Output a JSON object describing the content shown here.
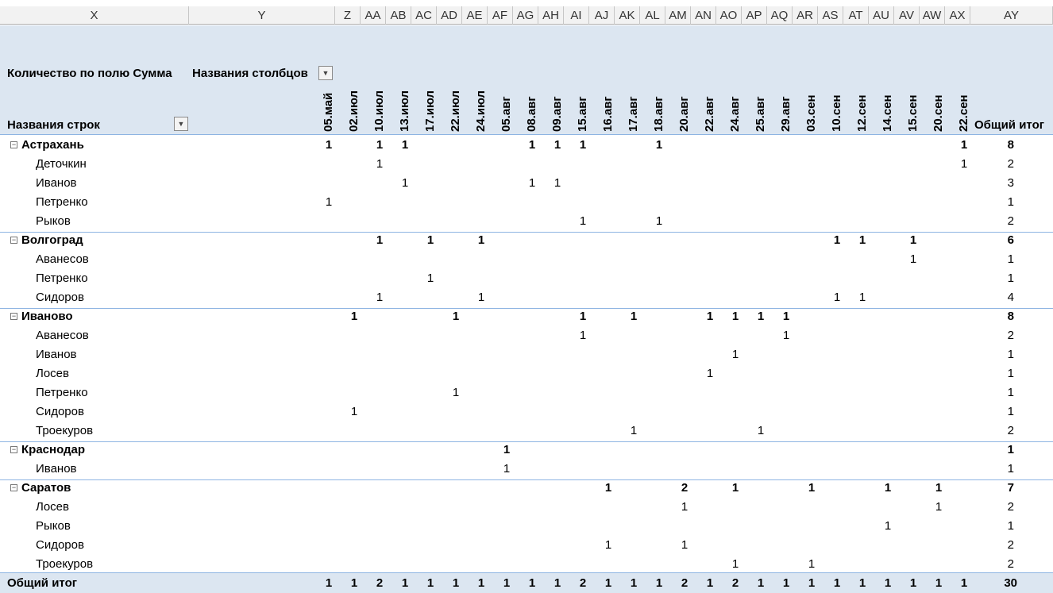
{
  "column_headers": [
    "X",
    "Y",
    "Z",
    "AA",
    "AB",
    "AC",
    "AD",
    "AE",
    "AF",
    "AG",
    "AH",
    "AI",
    "AJ",
    "AK",
    "AL",
    "AM",
    "AN",
    "AO",
    "AP",
    "AQ",
    "AR",
    "AS",
    "AT",
    "AU",
    "AV",
    "AW",
    "AX",
    "AY"
  ],
  "pivot": {
    "values_label": "Количество по полю Сумма",
    "columns_label": "Названия столбцов",
    "rows_label": "Названия строк",
    "grand_total_label": "Общий итог",
    "dates": [
      "05.май",
      "02.июл",
      "10.июл",
      "13.июл",
      "17.июл",
      "22.июл",
      "24.июл",
      "05.авг",
      "08.авг",
      "09.авг",
      "15.авг",
      "16.авг",
      "17.авг",
      "18.авг",
      "20.авг",
      "22.авг",
      "24.авг",
      "25.авг",
      "29.авг",
      "03.сен",
      "10.сен",
      "12.сен",
      "14.сен",
      "15.сен",
      "20.сен",
      "22.сен"
    ],
    "rows": [
      {
        "label": "Астрахань",
        "level": 0,
        "cells": {
          "0": "1",
          "2": "1",
          "3": "1",
          "8": "1",
          "9": "1",
          "10": "1",
          "13": "1",
          "25": "1"
        },
        "total": "8"
      },
      {
        "label": "Деточкин",
        "level": 1,
        "cells": {
          "2": "1",
          "25": "1"
        },
        "total": "2"
      },
      {
        "label": "Иванов",
        "level": 1,
        "cells": {
          "3": "1",
          "8": "1",
          "9": "1"
        },
        "total": "3"
      },
      {
        "label": "Петренко",
        "level": 1,
        "cells": {
          "0": "1"
        },
        "total": "1"
      },
      {
        "label": "Рыков",
        "level": 1,
        "cells": {
          "10": "1",
          "13": "1"
        },
        "total": "2"
      },
      {
        "label": "Волгоград",
        "level": 0,
        "cells": {
          "2": "1",
          "4": "1",
          "6": "1",
          "20": "1",
          "21": "1",
          "23": "1"
        },
        "total": "6"
      },
      {
        "label": "Аванесов",
        "level": 1,
        "cells": {
          "23": "1"
        },
        "total": "1"
      },
      {
        "label": "Петренко",
        "level": 1,
        "cells": {
          "4": "1"
        },
        "total": "1"
      },
      {
        "label": "Сидоров",
        "level": 1,
        "cells": {
          "2": "1",
          "6": "1",
          "20": "1",
          "21": "1"
        },
        "total": "4"
      },
      {
        "label": "Иваново",
        "level": 0,
        "cells": {
          "1": "1",
          "5": "1",
          "10": "1",
          "12": "1",
          "15": "1",
          "16": "1",
          "17": "1",
          "18": "1"
        },
        "total": "8"
      },
      {
        "label": "Аванесов",
        "level": 1,
        "cells": {
          "10": "1",
          "18": "1"
        },
        "total": "2"
      },
      {
        "label": "Иванов",
        "level": 1,
        "cells": {
          "16": "1"
        },
        "total": "1"
      },
      {
        "label": "Лосев",
        "level": 1,
        "cells": {
          "15": "1"
        },
        "total": "1"
      },
      {
        "label": "Петренко",
        "level": 1,
        "cells": {
          "5": "1"
        },
        "total": "1"
      },
      {
        "label": "Сидоров",
        "level": 1,
        "cells": {
          "1": "1"
        },
        "total": "1"
      },
      {
        "label": "Троекуров",
        "level": 1,
        "cells": {
          "12": "1",
          "17": "1"
        },
        "total": "2"
      },
      {
        "label": "Краснодар",
        "level": 0,
        "cells": {
          "7": "1"
        },
        "total": "1"
      },
      {
        "label": "Иванов",
        "level": 1,
        "cells": {
          "7": "1"
        },
        "total": "1"
      },
      {
        "label": "Саратов",
        "level": 0,
        "cells": {
          "11": "1",
          "14": "2",
          "16": "1",
          "19": "1",
          "22": "1",
          "24": "1"
        },
        "total": "7"
      },
      {
        "label": "Лосев",
        "level": 1,
        "cells": {
          "14": "1",
          "24": "1"
        },
        "total": "2"
      },
      {
        "label": "Рыков",
        "level": 1,
        "cells": {
          "22": "1"
        },
        "total": "1"
      },
      {
        "label": "Сидоров",
        "level": 1,
        "cells": {
          "11": "1",
          "14": "1"
        },
        "total": "2"
      },
      {
        "label": "Троекуров",
        "level": 1,
        "cells": {
          "16": "1",
          "19": "1"
        },
        "total": "2"
      }
    ],
    "grand_total_row": {
      "cells": [
        "1",
        "1",
        "2",
        "1",
        "1",
        "1",
        "1",
        "1",
        "1",
        "1",
        "2",
        "1",
        "1",
        "1",
        "2",
        "1",
        "2",
        "1",
        "1",
        "1",
        "1",
        "1",
        "1",
        "1",
        "1",
        "1"
      ],
      "total": "30"
    }
  },
  "icons": {
    "filter_dropdown": "dropdown-arrow-icon",
    "collapse": "minus-box-icon"
  },
  "colors": {
    "header_band": "#dce6f1",
    "column_header": "#f2f2f2"
  }
}
